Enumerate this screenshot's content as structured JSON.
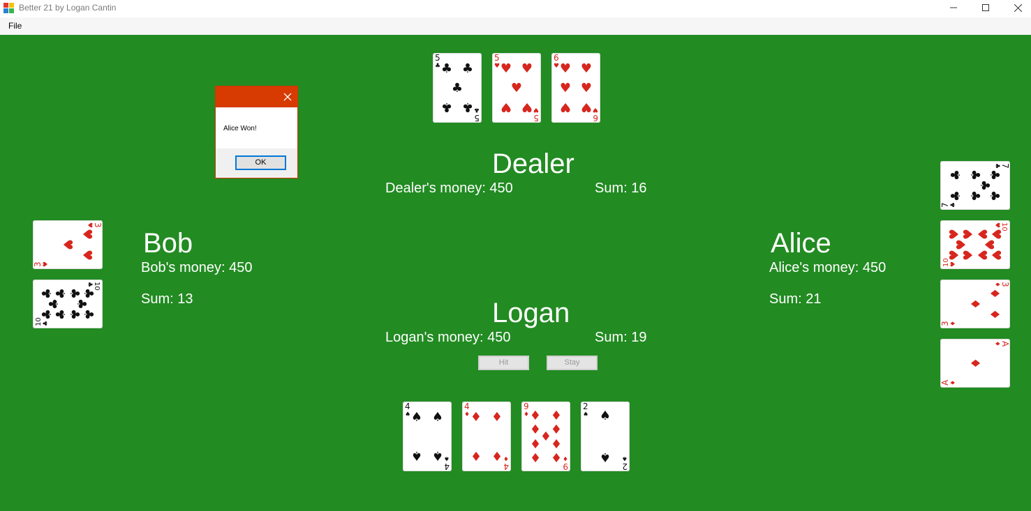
{
  "window": {
    "title": "Better 21 by Logan Cantin"
  },
  "menu": {
    "file": "File"
  },
  "colors": {
    "felt": "#228b22",
    "red_suit": "#d7261e",
    "black_suit": "#111111",
    "dialog_accent": "#d83b01"
  },
  "dealer": {
    "name": "Dealer",
    "money": "Dealer's money: 450",
    "sum": "Sum: 16",
    "cards": [
      {
        "rank": "5",
        "suit": "clubs"
      },
      {
        "rank": "5",
        "suit": "hearts"
      },
      {
        "rank": "6",
        "suit": "hearts"
      }
    ]
  },
  "bob": {
    "name": "Bob",
    "money": "Bob's money: 450",
    "sum": "Sum: 13",
    "cards": [
      {
        "rank": "3",
        "suit": "hearts"
      },
      {
        "rank": "10",
        "suit": "clubs"
      }
    ]
  },
  "alice": {
    "name": "Alice",
    "money": "Alice's money: 450",
    "sum": "Sum: 21",
    "cards": [
      {
        "rank": "7",
        "suit": "clubs"
      },
      {
        "rank": "10",
        "suit": "hearts"
      },
      {
        "rank": "3",
        "suit": "diamonds"
      },
      {
        "rank": "A",
        "suit": "diamonds"
      }
    ]
  },
  "logan": {
    "name": "Logan",
    "money": "Logan's money: 450",
    "sum": "Sum: 19",
    "cards": [
      {
        "rank": "4",
        "suit": "spades"
      },
      {
        "rank": "4",
        "suit": "diamonds"
      },
      {
        "rank": "9",
        "suit": "diamonds"
      },
      {
        "rank": "2",
        "suit": "spades"
      }
    ]
  },
  "controls": {
    "hit": "Hit",
    "stay": "Stay"
  },
  "dialog": {
    "message": "Alice Won!",
    "ok": "OK"
  }
}
